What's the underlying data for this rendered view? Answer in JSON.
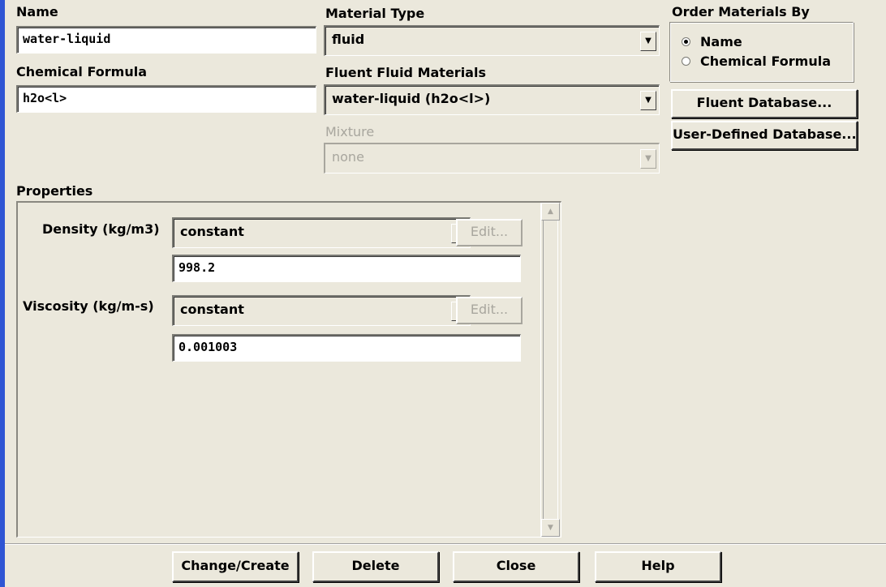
{
  "name": {
    "label": "Name",
    "value": "water-liquid"
  },
  "chemical_formula": {
    "label": "Chemical Formula",
    "value": "h2o<l>"
  },
  "material_type": {
    "label": "Material Type",
    "selected": "fluid"
  },
  "fluent_fluid_materials": {
    "label": "Fluent Fluid Materials",
    "selected": "water-liquid (h2o<l>)"
  },
  "mixture": {
    "label": "Mixture",
    "selected": "none"
  },
  "order_materials_by": {
    "label": "Order Materials By",
    "options": [
      {
        "label": "Name",
        "checked": true
      },
      {
        "label": "Chemical Formula",
        "checked": false
      }
    ]
  },
  "database_buttons": {
    "fluent_database": "Fluent Database...",
    "user_defined_database": "User-Defined Database..."
  },
  "properties": {
    "label": "Properties",
    "density": {
      "label": "Density (kg/m3)",
      "method": "constant",
      "edit": "Edit...",
      "value": "998.2"
    },
    "viscosity": {
      "label": "Viscosity (kg/m-s)",
      "method": "constant",
      "edit": "Edit...",
      "value": "0.001003"
    }
  },
  "footer_buttons": {
    "change_create": "Change/Create",
    "delete": "Delete",
    "close": "Close",
    "help": "Help"
  },
  "icons": {
    "dropdown_arrow": "▼",
    "scroll_up": "▲",
    "scroll_down": "▼"
  },
  "colors": {
    "window_bg": "#ebe8dc",
    "accent_bar": "#2f55d4",
    "disabled_text": "#a8a69e"
  }
}
